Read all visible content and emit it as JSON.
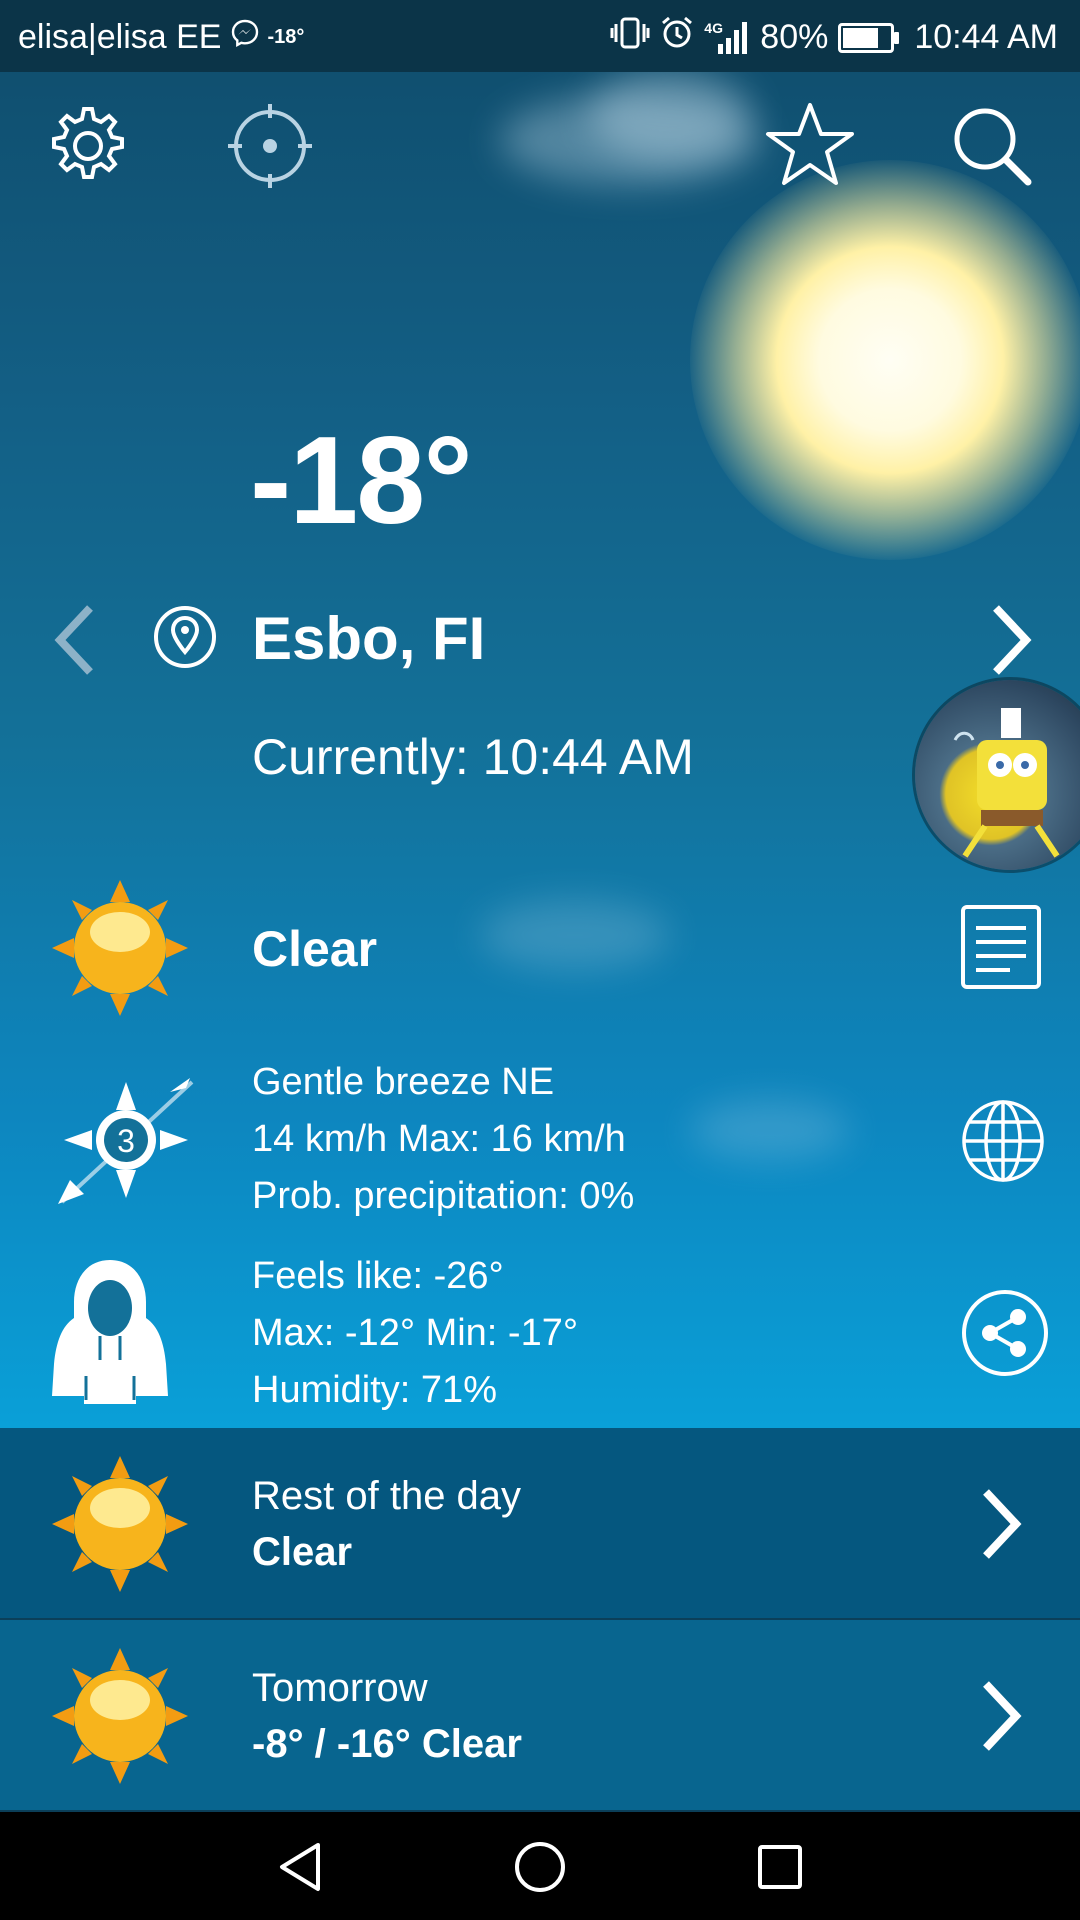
{
  "status_bar": {
    "carrier": "elisa|elisa EE",
    "small_temp": "-18°",
    "network": "4G",
    "battery": "80%",
    "battery_level": 0.8,
    "time": "10:44 AM"
  },
  "weather": {
    "temperature": "-18°",
    "location": "Esbo, FI",
    "current_time": "Currently: 10:44 AM",
    "condition": "Clear",
    "wind_force": "3",
    "wind_line1": "Gentle breeze NE",
    "wind_line2": "14 km/h Max: 16 km/h",
    "wind_line3": "Prob. precipitation: 0%",
    "feels_line1": "Feels like: -26°",
    "feels_line2": "Max: -12° Min: -17°",
    "feels_line3": "Humidity: 71%"
  },
  "forecast": [
    {
      "title": "Rest of the day",
      "summary": "Clear"
    },
    {
      "title": "Tomorrow",
      "summary": "-8° / -16° Clear"
    }
  ],
  "colors": {
    "status_bar": "#0b3448",
    "row_rest_of_day": "#05577f",
    "row_tomorrow": "#08658f",
    "sun_icon": "#f7b41c"
  },
  "icons": [
    "settings-gear-icon",
    "locate-icon",
    "favorite-star-icon",
    "search-icon",
    "location-pin-icon",
    "prev-location-chevron-icon",
    "next-location-chevron-icon",
    "sun-icon",
    "wind-compass-icon",
    "hoodie-icon",
    "details-list-icon",
    "globe-icon",
    "share-icon",
    "chevron-right-icon"
  ]
}
